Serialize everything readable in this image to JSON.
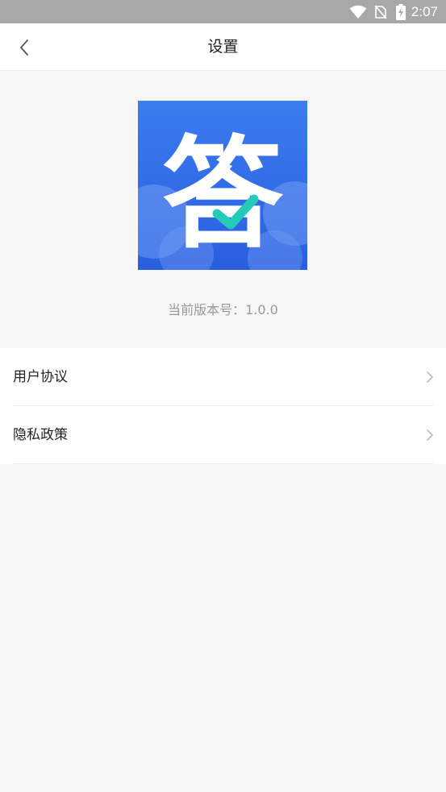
{
  "status_bar": {
    "time": "2:07",
    "icons": [
      "wifi-icon",
      "no-sim-icon",
      "battery-charging-icon"
    ]
  },
  "header": {
    "title": "设置",
    "back_icon": "chevron-left-icon"
  },
  "app_info": {
    "logo_character": "答",
    "logo_colors": {
      "top": "#3b7cf0",
      "bottom": "#2a5fe0",
      "check": "#27c9b8"
    },
    "version_text": "当前版本号：1.0.0"
  },
  "menu": {
    "items": [
      {
        "label": "用户协议",
        "icon": "chevron-right-icon"
      },
      {
        "label": "隐私政策",
        "icon": "chevron-right-icon"
      }
    ]
  }
}
